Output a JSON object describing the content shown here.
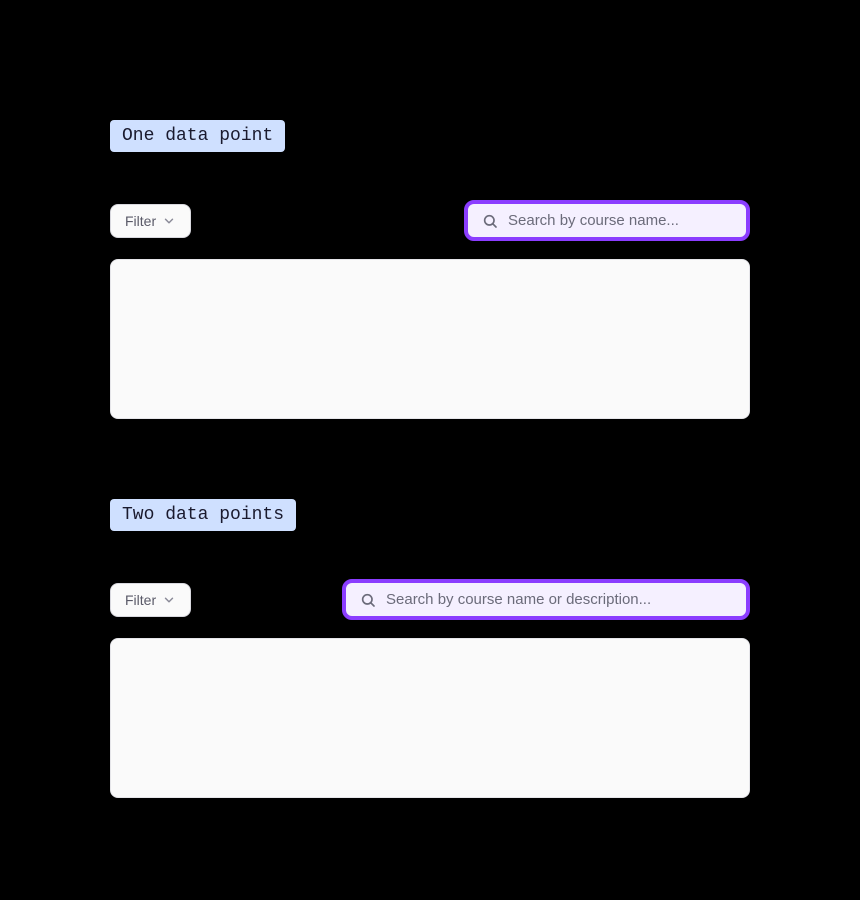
{
  "sections": [
    {
      "label": "One data point",
      "filter_label": "Filter",
      "search_placeholder": "Search by course name..."
    },
    {
      "label": "Two data points",
      "filter_label": "Filter",
      "search_placeholder": "Search by course name or description..."
    }
  ]
}
